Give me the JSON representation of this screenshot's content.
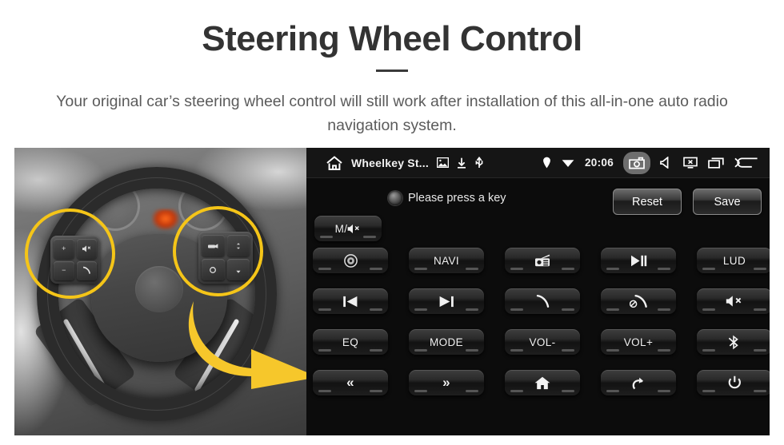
{
  "header": {
    "title": "Steering Wheel Control",
    "subtitle": "Your original car’s steering wheel control will still work after installation of this all-in-one auto radio navigation system."
  },
  "photo": {
    "alt_label": "car-steering-wheel-with-control-buttons",
    "highlight_color": "#F5C518",
    "arrow_color": "#F6C72B",
    "left_pad_keys": [
      "+",
      "mute-icon",
      "-",
      "phone-icon"
    ],
    "right_pad_keys": [
      "source-icon",
      "up-icon",
      "circle-icon",
      "down-icon"
    ]
  },
  "head_unit": {
    "status_bar": {
      "home_icon": "home-icon",
      "app_title": "Wheelkey St...",
      "left_icons": [
        "image-icon",
        "download-icon",
        "usb-icon"
      ],
      "location_icon": "location-pin-icon",
      "wifi_icon": "wifi-icon",
      "time": "20:06",
      "right_icons": [
        "screenshot-icon",
        "volume-icon",
        "screen-off-icon",
        "recents-icon",
        "back-icon"
      ],
      "active_icon": "screenshot-icon",
      "active_icon_bg": "#6E6E6E"
    },
    "prompt": {
      "indicator": "status-led",
      "text": "Please press a key"
    },
    "buttons": {
      "reset_label": "Reset",
      "save_label": "Save"
    },
    "mute_key": {
      "label": "M/",
      "icon": "mute-icon"
    },
    "keys": [
      {
        "name": "key-disc",
        "label": "",
        "icon": "disc-icon"
      },
      {
        "name": "key-navi",
        "label": "NAVI",
        "icon": ""
      },
      {
        "name": "key-radio",
        "label": "",
        "icon": "radio-icon"
      },
      {
        "name": "key-playpause",
        "label": "",
        "icon": "play-pause-icon"
      },
      {
        "name": "key-lud",
        "label": "LUD",
        "icon": ""
      },
      {
        "name": "key-previous",
        "label": "",
        "icon": "previous-track-icon"
      },
      {
        "name": "key-next",
        "label": "",
        "icon": "next-track-icon"
      },
      {
        "name": "key-call",
        "label": "",
        "icon": "phone-icon"
      },
      {
        "name": "key-hangup",
        "label": "",
        "icon": "hangup-icon"
      },
      {
        "name": "key-mute",
        "label": "",
        "icon": "mute-icon"
      },
      {
        "name": "key-eq",
        "label": "EQ",
        "icon": ""
      },
      {
        "name": "key-mode",
        "label": "MODE",
        "icon": ""
      },
      {
        "name": "key-vol-down",
        "label": "VOL-",
        "icon": ""
      },
      {
        "name": "key-vol-up",
        "label": "VOL+",
        "icon": ""
      },
      {
        "name": "key-bluetooth",
        "label": "",
        "icon": "bluetooth-icon"
      },
      {
        "name": "key-rewind",
        "label": "«",
        "icon": ""
      },
      {
        "name": "key-forward",
        "label": "»",
        "icon": ""
      },
      {
        "name": "key-home",
        "label": "",
        "icon": "home-solid-icon"
      },
      {
        "name": "key-return",
        "label": "",
        "icon": "redo-arrow-icon"
      },
      {
        "name": "key-power",
        "label": "",
        "icon": "power-icon"
      }
    ]
  }
}
